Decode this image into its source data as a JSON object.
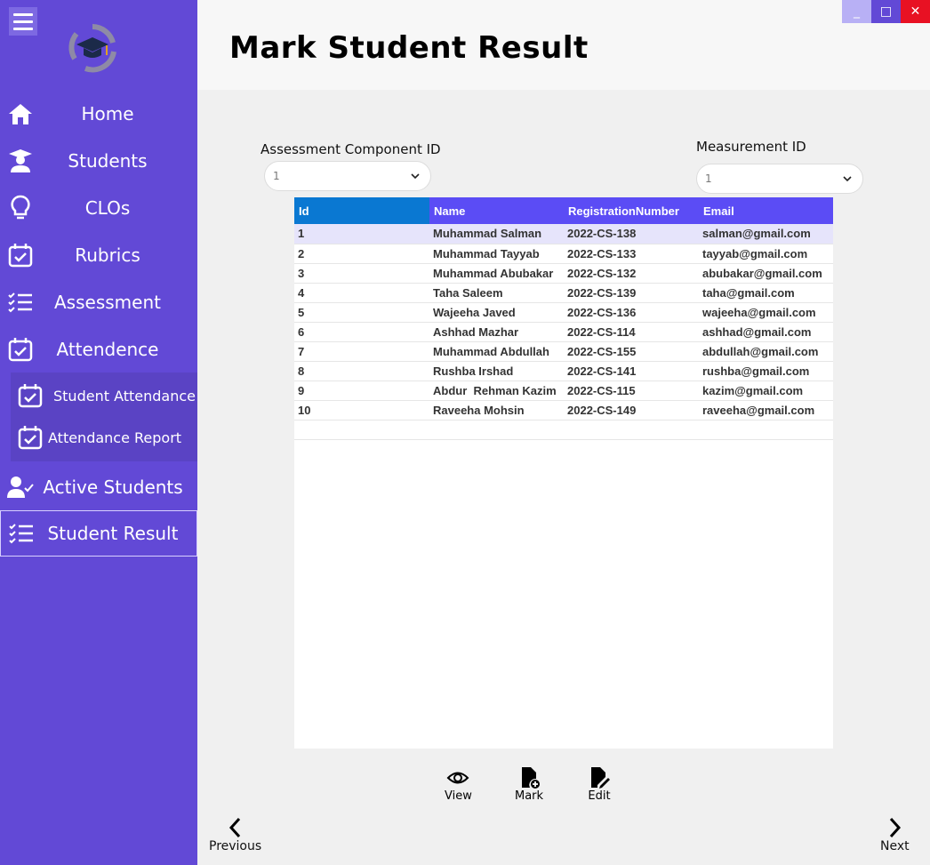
{
  "sidebar": {
    "items": [
      {
        "label": "Home",
        "icon": "home-icon"
      },
      {
        "label": "Students",
        "icon": "student-icon"
      },
      {
        "label": "CLOs",
        "icon": "lightbulb-icon"
      },
      {
        "label": "Rubrics",
        "icon": "calendar-check-icon"
      },
      {
        "label": "Assessment",
        "icon": "checklist-icon"
      },
      {
        "label": "Attendence",
        "icon": "calendar-check-icon"
      },
      {
        "label": "Active Students",
        "icon": "user-check-icon"
      },
      {
        "label": "Student Result",
        "icon": "checklist-icon"
      }
    ],
    "subitems": [
      {
        "label": "Student Attendance",
        "icon": "calendar-check-icon"
      },
      {
        "label": "Attendance Report",
        "icon": "calendar-check-icon"
      }
    ]
  },
  "header": {
    "title": "Mark Student Result"
  },
  "window": {
    "minimize": "_",
    "maximize": "□",
    "close": "✕"
  },
  "form": {
    "assessment_label": "Assessment Component ID",
    "assessment_value": "1",
    "measurement_label": "Measurement ID",
    "measurement_value": "1"
  },
  "table": {
    "columns": [
      "Id",
      "Name",
      "RegistrationNumber",
      "Email"
    ],
    "rows": [
      [
        "1",
        "Muhammad Salman",
        "2022-CS-138",
        "salman@gmail.com"
      ],
      [
        "2",
        "Muhammad Tayyab",
        "2022-CS-133",
        "tayyab@gmail.com"
      ],
      [
        "3",
        "Muhammad Abubakar",
        "2022-CS-132",
        "abubakar@gmail.com"
      ],
      [
        "4",
        "Taha Saleem",
        "2022-CS-139",
        "taha@gmail.com"
      ],
      [
        "5",
        "Wajeeha Javed",
        "2022-CS-136",
        "wajeeha@gmail.com"
      ],
      [
        "6",
        "Ashhad Mazhar",
        "2022-CS-114",
        "ashhad@gmail.com"
      ],
      [
        "7",
        "Muhammad Abdullah",
        "2022-CS-155",
        "abdullah@gmail.com"
      ],
      [
        "8",
        "Rushba Irshad",
        "2022-CS-141",
        "rushba@gmail.com"
      ],
      [
        "9",
        "Abdur  Rehman Kazim",
        "2022-CS-115",
        "kazim@gmail.com"
      ],
      [
        "10",
        "Raveeha Mohsin",
        "2022-CS-149",
        "raveeha@gmail.com"
      ]
    ]
  },
  "actions": {
    "view": "View",
    "mark": "Mark",
    "edit": "Edit"
  },
  "pager": {
    "previous": "Previous",
    "next": "Next"
  },
  "colors": {
    "sidebar": "#6249d6",
    "header_id": "#0a78d2",
    "header": "#5b4cf5",
    "close": "#e81123"
  }
}
